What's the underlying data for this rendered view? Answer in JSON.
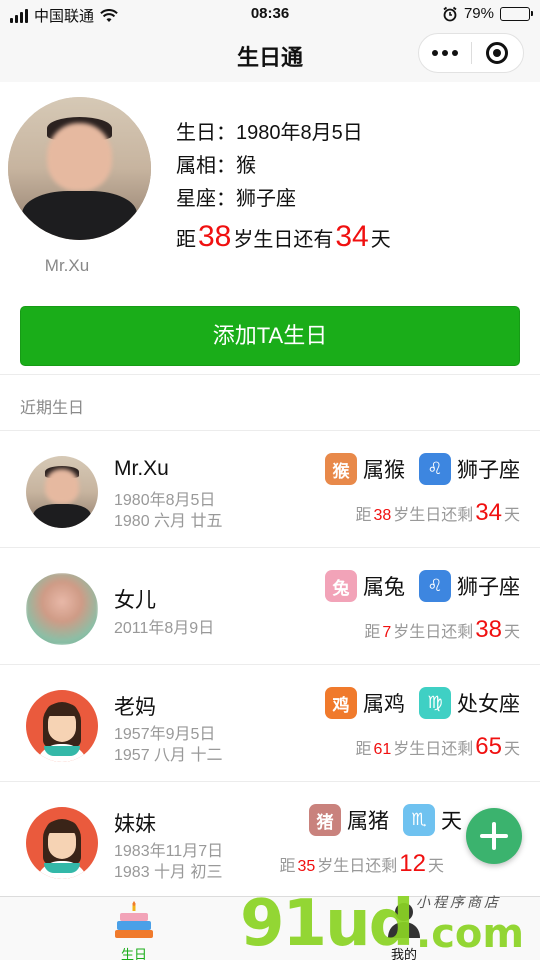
{
  "status_bar": {
    "carrier": "中国联通",
    "time": "08:36",
    "battery": "79%",
    "battery_level": 0.79
  },
  "nav": {
    "title": "生日通"
  },
  "profile": {
    "name": "Mr.Xu",
    "birthday_label": "生日：",
    "birthday": "1980年8月5日",
    "zodiac_label": "属相：",
    "zodiac": "猴",
    "constellation_label": "星座：",
    "constellation": "狮子座",
    "countdown_prefix": "距",
    "age": "38",
    "countdown_mid": "岁生日还有",
    "days": "34",
    "countdown_suffix": "天"
  },
  "add_button": "添加TA生日",
  "section_title": "近期生日",
  "list": [
    {
      "name": "Mr.Xu",
      "solar": "1980年8月5日",
      "lunar": "1980 六月 廿五",
      "zodiac": "属猴",
      "constellation": "狮子座",
      "c_prefix": "距",
      "age": "38",
      "c_mid": "岁生日还剩",
      "days": "34",
      "c_suffix": "天",
      "zodiac_color": "#e8894a",
      "constellation_color": "#3d86e0"
    },
    {
      "name": "女儿",
      "solar": "2011年8月9日",
      "lunar": "",
      "zodiac": "属兔",
      "constellation": "狮子座",
      "c_prefix": "距",
      "age": "7",
      "c_mid": "岁生日还剩",
      "days": "38",
      "c_suffix": "天",
      "zodiac_color": "#f2a3b8",
      "constellation_color": "#3d86e0"
    },
    {
      "name": "老妈",
      "solar": "1957年9月5日",
      "lunar": "1957 八月 十二",
      "zodiac": "属鸡",
      "constellation": "处女座",
      "c_prefix": "距",
      "age": "61",
      "c_mid": "岁生日还剩",
      "days": "65",
      "c_suffix": "天",
      "zodiac_color": "#f07a2c",
      "constellation_color": "#3fd0c4"
    },
    {
      "name": "妹妹",
      "solar": "1983年11月7日",
      "lunar": "1983 十月 初三",
      "zodiac": "属猪",
      "constellation": "天",
      "c_prefix": "距",
      "age": "35",
      "c_mid": "岁生日还剩",
      "days": "12",
      "c_suffix": "天",
      "zodiac_color": "#c9827d",
      "constellation_color": "#6fc2f0"
    }
  ],
  "tabs": {
    "home": "生日",
    "mine": "我的"
  },
  "watermark": {
    "big": "91ud",
    "com": ".com",
    "small": "小程序商店"
  }
}
